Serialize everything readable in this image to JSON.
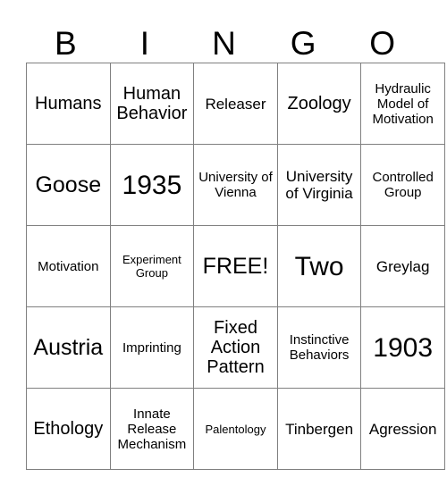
{
  "card": {
    "header": {
      "letters": [
        "B",
        "I",
        "N",
        "G",
        "O"
      ]
    },
    "rows": [
      [
        {
          "text": "Humans",
          "size": "s-md"
        },
        {
          "text": "Human Behavior",
          "size": "s-md"
        },
        {
          "text": "Releaser",
          "size": "s-sm"
        },
        {
          "text": "Zoology",
          "size": "s-md"
        },
        {
          "text": "Hydraulic Model of Motivation",
          "size": "s-xs"
        }
      ],
      [
        {
          "text": "Goose",
          "size": "s-lg"
        },
        {
          "text": "1935",
          "size": "s-xl"
        },
        {
          "text": "University of Vienna",
          "size": "s-xs"
        },
        {
          "text": "University of Virginia",
          "size": "s-sm"
        },
        {
          "text": "Controlled Group",
          "size": "s-xs"
        }
      ],
      [
        {
          "text": "Motivation",
          "size": "s-xs"
        },
        {
          "text": "Experiment Group",
          "size": "s-xxs"
        },
        {
          "text": "FREE!",
          "size": "s-lg"
        },
        {
          "text": "Two",
          "size": "s-xl"
        },
        {
          "text": "Greylag",
          "size": "s-sm"
        }
      ],
      [
        {
          "text": "Austria",
          "size": "s-lg"
        },
        {
          "text": "Imprinting",
          "size": "s-xs"
        },
        {
          "text": "Fixed Action Pattern",
          "size": "s-md"
        },
        {
          "text": "Instinctive Behaviors",
          "size": "s-xs"
        },
        {
          "text": "1903",
          "size": "s-xl"
        }
      ],
      [
        {
          "text": "Ethology",
          "size": "s-md"
        },
        {
          "text": "Innate Release Mechanism",
          "size": "s-xs"
        },
        {
          "text": "Palentology",
          "size": "s-xxs"
        },
        {
          "text": "Tinbergen",
          "size": "s-sm"
        },
        {
          "text": "Agression",
          "size": "s-sm"
        }
      ]
    ]
  },
  "colors": {
    "border": "#808080",
    "text": "#000000",
    "background": "#ffffff"
  }
}
